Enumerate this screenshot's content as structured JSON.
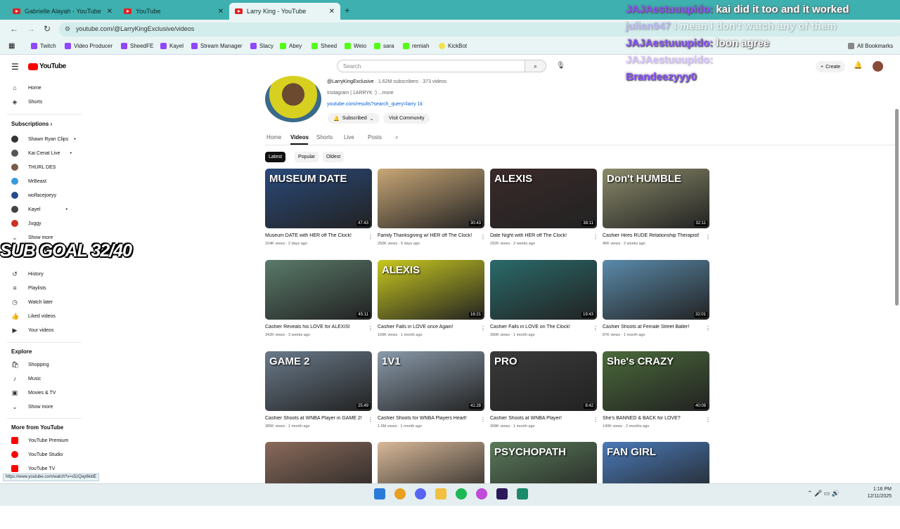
{
  "browser": {
    "tabs": [
      {
        "label": "Gabrielle Alayah - YouTube",
        "active": false
      },
      {
        "label": "YouTube",
        "active": false
      },
      {
        "label": "Larry King - YouTube",
        "active": true
      }
    ],
    "url": "youtube.com/@LarryKingExclusive/videos",
    "bookmarks": [
      "Twitch",
      "Video Producer",
      "SheedFE",
      "Kayel",
      "Stream Manager",
      "Stacy",
      "Abey",
      "Sheed",
      "Weio",
      "sara",
      "remiah",
      "KickBot"
    ],
    "all_bookmarks": "All Bookmarks",
    "status_url": "https://www.youtube.com/watch?v=s5zQay6kldE"
  },
  "chat": [
    {
      "user": "JAJAestuuupido:",
      "msg": "kai did it too and it worked",
      "faded": false
    },
    {
      "user": "julian947",
      "msg": "I mean I don't watch any of them",
      "faded": true
    },
    {
      "user": "JAJAestuuupido:",
      "msg": "loon agree",
      "faded": false
    },
    {
      "user": "JAJAestuuupido:",
      "msg": "",
      "faded": true
    },
    {
      "user": "Brandeezyyy0",
      "msg": "",
      "faded": false
    }
  ],
  "overlay": {
    "sub_goal": "SUB GOAL 32/40"
  },
  "youtube": {
    "logo": "YouTube",
    "search_placeholder": "Search",
    "create": "Create",
    "sidebar": {
      "main": [
        {
          "label": "Home",
          "icon": "home-icon"
        },
        {
          "label": "Shorts",
          "icon": "shorts-icon"
        }
      ],
      "subscriptions_title": "Subscriptions",
      "subscriptions": [
        {
          "label": "Shawn Ryan Clips",
          "color": "#333333"
        },
        {
          "label": "Kai Cenat Live",
          "color": "#555555"
        },
        {
          "label": "THURL DES",
          "color": "#7a5a4a"
        },
        {
          "label": "MrBeast",
          "color": "#3a9ad9"
        },
        {
          "label": "wolfacejoeyy",
          "color": "#2a4a8a"
        },
        {
          "label": "Kayel",
          "color": "#444444"
        },
        {
          "label": "Juggy",
          "color": "#cc3322"
        }
      ],
      "show_more": "Show more",
      "you": [
        {
          "label": "History",
          "icon": "history-icon"
        },
        {
          "label": "Playlists",
          "icon": "playlists-icon"
        },
        {
          "label": "Watch later",
          "icon": "watch-later-icon"
        },
        {
          "label": "Liked videos",
          "icon": "liked-icon"
        },
        {
          "label": "Your videos",
          "icon": "your-videos-icon"
        }
      ],
      "explore_title": "Explore",
      "explore": [
        {
          "label": "Shopping",
          "icon": "shopping-icon"
        },
        {
          "label": "Music",
          "icon": "music-icon"
        },
        {
          "label": "Movies & TV",
          "icon": "movies-icon"
        },
        {
          "label": "Show more",
          "icon": "chevron-down-icon"
        }
      ],
      "more_title": "More from YouTube",
      "more": [
        {
          "label": "YouTube Premium"
        },
        {
          "label": "YouTube Studio"
        },
        {
          "label": "YouTube TV"
        }
      ]
    },
    "channel": {
      "handle": "@LarryKingExclusive",
      "stats": "· 1.62M subscribers · 373 videos",
      "bio": "Instagram | 1ARRYK :) ...more",
      "link": "youtube.com/results?search_query=larry 1k",
      "subscribed": "Subscribed",
      "visit": "Visit Community",
      "tabs": [
        "Home",
        "Videos",
        "Shorts",
        "Live",
        "Posts"
      ],
      "active_tab": "Videos",
      "chips": [
        "Latest",
        "Popular",
        "Oldest"
      ]
    },
    "videos": [
      {
        "title": "Museum DATE with HER off The Clock!",
        "meta": "164K views · 2 days ago",
        "dur": "47:43",
        "overlay": "MUSEUM DATE",
        "bg": "#2a4a7a"
      },
      {
        "title": "Family Thanksgiving w/ HER off The Clock!",
        "meta": "250K views · 5 days ago",
        "dur": "30:43",
        "overlay": "",
        "bg": "#c9a777"
      },
      {
        "title": "Date Night with HER off The Clock!",
        "meta": "292K views · 2 weeks ago",
        "dur": "38:11",
        "overlay": "ALEXIS",
        "bg": "#3a2a2a"
      },
      {
        "title": "Cashier Hires RUDE Relationship Therapist!",
        "meta": "46K views · 2 weeks ago",
        "dur": "32:11",
        "overlay": "Don't HUMBLE",
        "bg": "#8a8a6a"
      },
      {
        "title": "Cashier Reveals his LOVE for ALEXIS!",
        "meta": "342K views · 3 weeks ago",
        "dur": "45:11",
        "overlay": "",
        "bg": "#5a7a6a"
      },
      {
        "title": "Cashier Falls in LOVE once Again!",
        "meta": "109K views · 1 month ago",
        "dur": "16:21",
        "overlay": "ALEXIS",
        "bg": "#c8c820"
      },
      {
        "title": "Cashier Falls in LOVE on The Clock!",
        "meta": "390K views · 1 month ago",
        "dur": "19:43",
        "overlay": "",
        "bg": "#2a6a6a"
      },
      {
        "title": "Cashier Shoots at Female Street Baller!",
        "meta": "87K views · 1 month ago",
        "dur": "32:01",
        "overlay": "",
        "bg": "#5a8aaa"
      },
      {
        "title": "Cashier Shoots at WNBA Player in GAME 2!",
        "meta": "385K views · 1 month ago",
        "dur": "25:49",
        "overlay": "GAME 2",
        "bg": "#6a7a8a"
      },
      {
        "title": "Cashier Shoots for WNBA Players Heart!",
        "meta": "1.6M views · 1 month ago",
        "dur": "41:28",
        "overlay": "1V1",
        "bg": "#8a9aaa"
      },
      {
        "title": "Cashier Shoots at WNBA Player!",
        "meta": "308K views · 1 month ago",
        "dur": "8:42",
        "overlay": "PRO",
        "bg": "#3a3a3a"
      },
      {
        "title": "She's BANNED & BACK for LOVE?",
        "meta": "140K views · 2 months ago",
        "dur": "40:09",
        "overlay": "She's CRAZY",
        "bg": "#4a6a3a"
      },
      {
        "title": "",
        "meta": "",
        "dur": "",
        "overlay": "",
        "bg": "#8a6a5a"
      },
      {
        "title": "",
        "meta": "",
        "dur": "",
        "overlay": "",
        "bg": "#d8b898"
      },
      {
        "title": "",
        "meta": "",
        "dur": "",
        "overlay": "PSYCHOPATH",
        "bg": "#5a7a5a"
      },
      {
        "title": "",
        "meta": "",
        "dur": "",
        "overlay": "FAN GIRL",
        "bg": "#4a7ab8"
      }
    ]
  },
  "taskbar": {
    "time": "1:16 PM",
    "date": "12/11/2025"
  }
}
